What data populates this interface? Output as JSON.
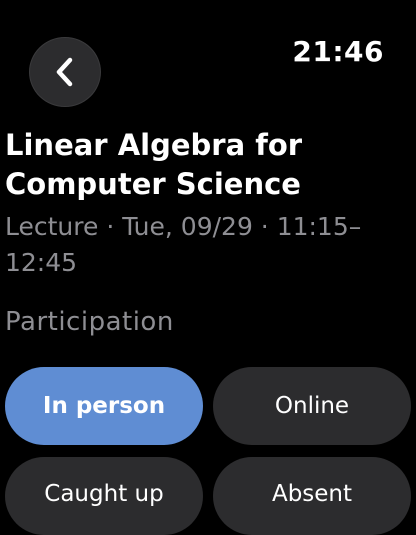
{
  "status_bar": {
    "time": "21:46"
  },
  "header": {
    "back_icon": "chevron-left-icon"
  },
  "event": {
    "title": "Linear Algebra for Computer Science",
    "subtitle": "Lecture · Tue, 09/29 · 11:15–12:45"
  },
  "participation": {
    "label": "Participation",
    "selected": "In person",
    "options": [
      {
        "label": "In person"
      },
      {
        "label": "Online"
      },
      {
        "label": "Caught up"
      },
      {
        "label": "Absent"
      }
    ]
  },
  "colors": {
    "accent": "#5f8dd3",
    "button_bg": "#2c2c2e",
    "secondary_text": "#8e8e93",
    "background": "#000000"
  }
}
